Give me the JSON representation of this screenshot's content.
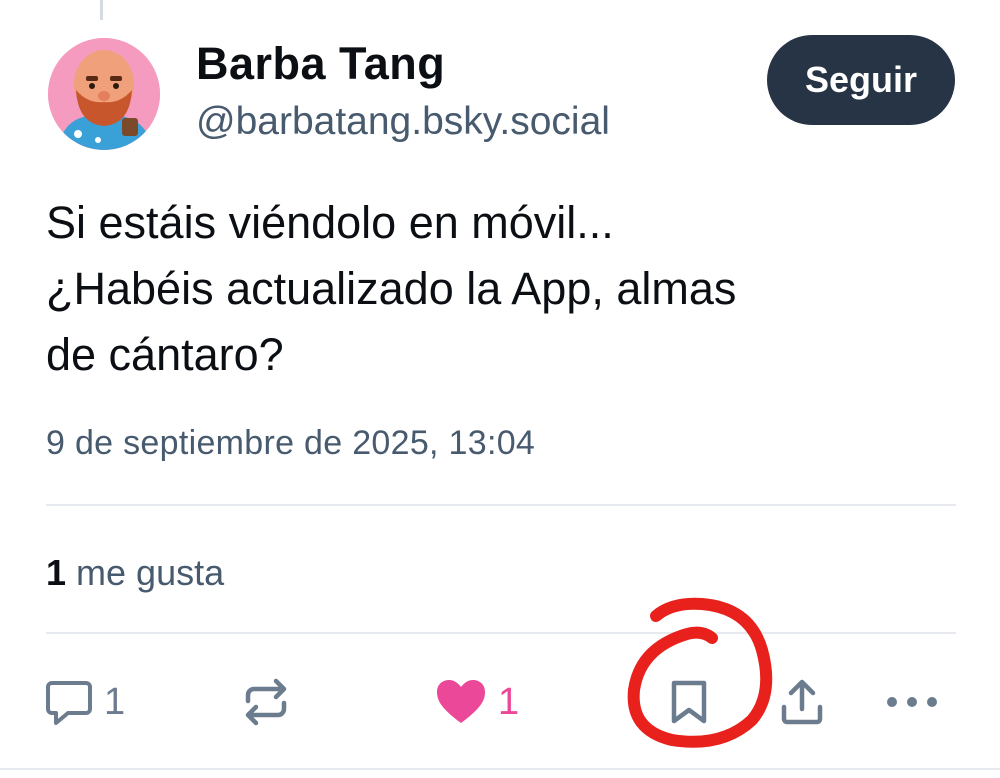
{
  "post": {
    "author": {
      "display_name": "Barba Tang",
      "handle": "@barbatang.bsky.social"
    },
    "follow_label": "Seguir",
    "text_lines": [
      "Si estáis viéndolo en móvil...",
      "¿Habéis actualizado la App, almas",
      "de cántaro?"
    ],
    "timestamp": "9 de septiembre de 2025, 13:04",
    "likes": {
      "count": "1",
      "label": "me gusta"
    }
  },
  "actions": {
    "reply": {
      "icon": "reply-icon",
      "count": "1"
    },
    "repost": {
      "icon": "repost-icon"
    },
    "like": {
      "icon": "heart-icon",
      "count": "1"
    },
    "bookmark": {
      "icon": "bookmark-icon"
    },
    "share": {
      "icon": "share-icon"
    },
    "more": {
      "icon": "more-icon"
    }
  },
  "colors": {
    "follow_button_bg": "#263445",
    "secondary_text": "#475a6e",
    "like_pink": "#ec4899",
    "annotation_red": "#e8211c"
  }
}
